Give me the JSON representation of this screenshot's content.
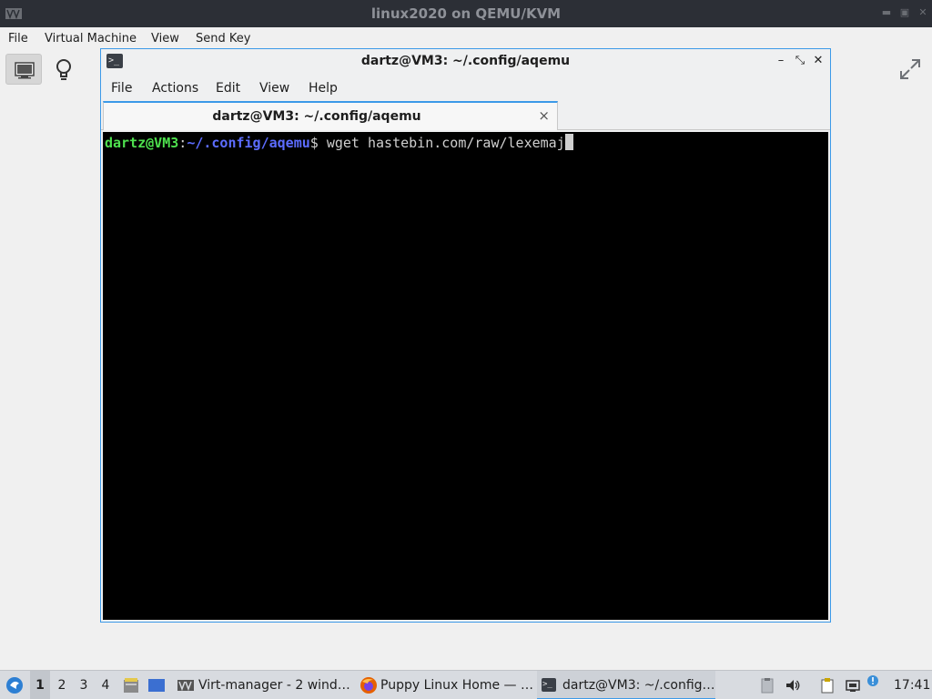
{
  "outer_window": {
    "title": "linux2020 on QEMU/KVM",
    "menu": [
      "File",
      "Virtual Machine",
      "View",
      "Send Key"
    ],
    "toolbar": {
      "console_icon": "monitor-icon",
      "details_icon": "lightbulb-icon",
      "fullscreen_icon": "expand-arrows-icon"
    }
  },
  "terminal_window": {
    "title": "dartz@VM3: ~/.config/aqemu",
    "menu": [
      "File",
      "Actions",
      "Edit",
      "View",
      "Help"
    ],
    "tab_label": "dartz@VM3: ~/.config/aqemu",
    "tab_close": "×",
    "prompt_user": "dartz@VM3",
    "prompt_sep": ":",
    "prompt_path": "~/.config/aqemu",
    "prompt_symbol": "$",
    "command": " wget hastebin.com/raw/lexemaj"
  },
  "taskbar": {
    "workspaces": [
      "1",
      "2",
      "3",
      "4"
    ],
    "active_workspace": "1",
    "tasks": [
      {
        "label": "Virt-manager - 2 wind…",
        "icon": "virt-manager-icon"
      },
      {
        "label": "Puppy Linux Home — …",
        "icon": "firefox-icon"
      },
      {
        "label": "dartz@VM3: ~/.config…",
        "icon": "terminal-icon",
        "active": true
      }
    ],
    "clock": "17:41"
  },
  "colors": {
    "accent": "#3c9ae8",
    "prompt_user": "#4ee04e",
    "prompt_path": "#5c6cff",
    "terminal_bg": "#000000"
  }
}
